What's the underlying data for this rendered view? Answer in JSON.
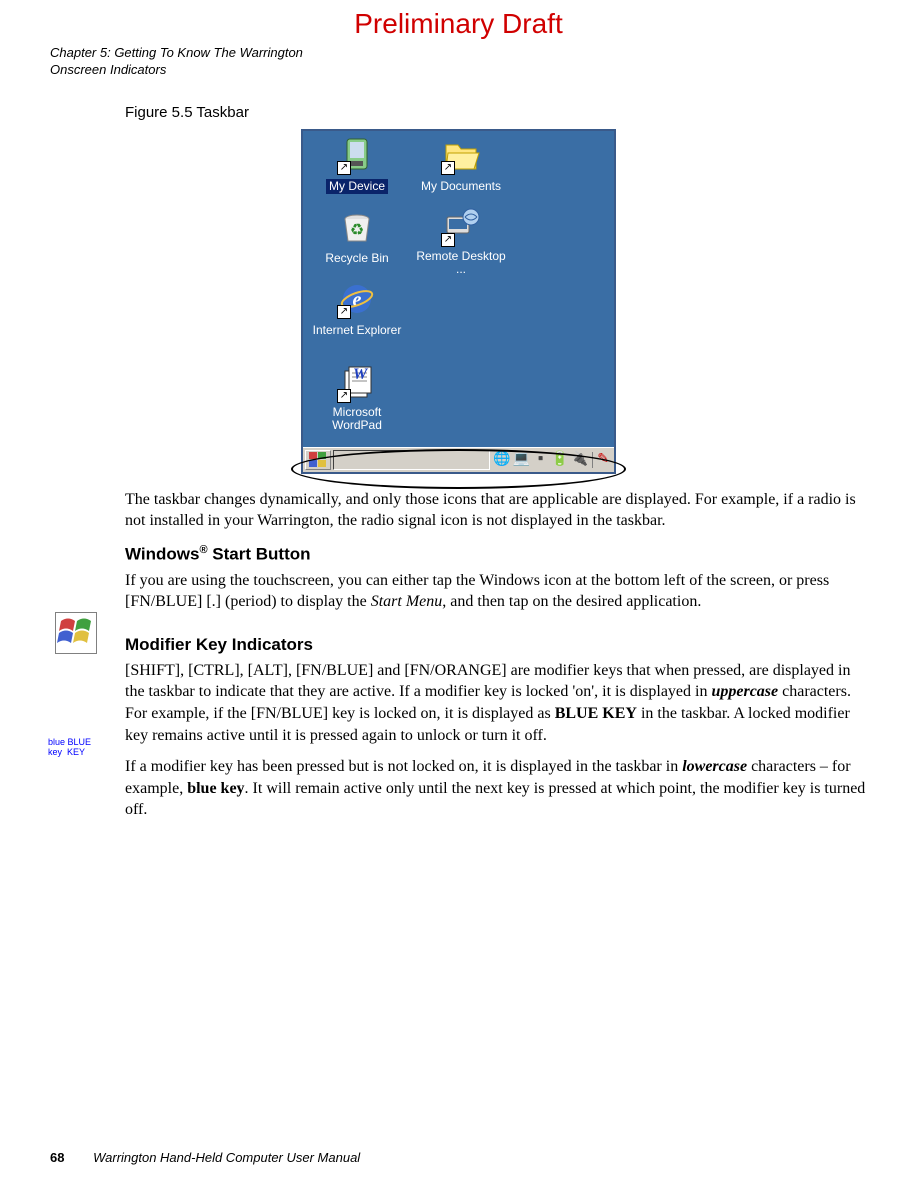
{
  "watermark": "Preliminary Draft",
  "header": {
    "line1": "Chapter 5: Getting To Know The Warrington",
    "line2": "Onscreen Indicators"
  },
  "figure": {
    "caption": "Figure 5.5  Taskbar",
    "desktop_icons": [
      {
        "label": "My Device",
        "selected": true
      },
      {
        "label": "My Documents",
        "selected": false
      },
      {
        "label": "Recycle Bin",
        "selected": false
      },
      {
        "label": "Remote Desktop ...",
        "selected": false
      },
      {
        "label": "Internet Explorer",
        "selected": false
      },
      {
        "label": "Microsoft WordPad",
        "selected": false
      }
    ]
  },
  "paragraphs": {
    "p1": "The taskbar changes dynamically, and only those icons that are applicable are displayed. For example, if a radio is not installed in your Warrington, the radio signal icon is not displayed in the taskbar."
  },
  "sections": {
    "s1": {
      "heading_pre": "Windows",
      "heading_sup": "®",
      "heading_post": " Start Button",
      "body_parts": {
        "t1": "If you are using the touchscreen, you can either tap the Windows icon at the bottom left of the screen, or press [FN/BLUE] [.] (period) to display the ",
        "i1": "Start Menu",
        "t2": ", and then tap on the desired application."
      },
      "side_icon_text": ""
    },
    "s2": {
      "heading": "Modifier Key Indicators",
      "side_icon_text": "blue BLUE\nkey  KEY",
      "body1": {
        "t1": "[SHIFT], [CTRL], [ALT], [FN/BLUE] and [FN/ORANGE] are modifier keys that when pressed, are displayed in the taskbar to indicate that they are active. If a modifier key is locked 'on', it is displayed in ",
        "bi1": "uppercase",
        "t2": " characters. For example, if the [FN/BLUE] key is locked on, it is displayed as ",
        "b1": "BLUE KEY",
        "t3": " in the taskbar. A locked modifier key remains active until it is pressed again to unlock or turn it off."
      },
      "body2": {
        "t1": "If a modifier key has been pressed but is not locked on, it is displayed in the taskbar in ",
        "bi1": "lowercase",
        "t2": " characters – for example, ",
        "b1": "blue key",
        "t3": ". It will remain active only until the next key is pressed at which point, the modifier key is turned off."
      }
    }
  },
  "footer": {
    "page_num": "68",
    "title": "Warrington Hand-Held Computer User Manual"
  }
}
